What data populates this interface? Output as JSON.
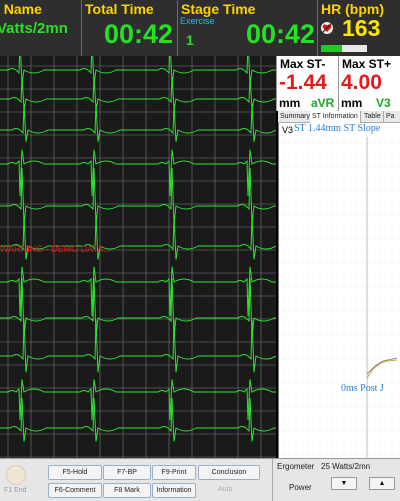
{
  "header": {
    "name": {
      "label": "l Name",
      "value": "Vatts/2mn"
    },
    "total_time": {
      "label": "Total Time",
      "value": "00:42"
    },
    "stage_time": {
      "label": "Stage Time",
      "sub_label": "Exercise",
      "stage_number": "1",
      "value": "00:42"
    },
    "heart_rate": {
      "label": "HR (bpm)",
      "value": "163",
      "icon": "heart-rate-icon",
      "fraction_of_bar": 0.45
    }
  },
  "st": {
    "max_minus": {
      "label": "Max ST-",
      "value": "-1.44",
      "unit": "mm",
      "lead": "aVR"
    },
    "max_plus": {
      "label": "Max ST+",
      "value": "4.00",
      "unit": "mm",
      "lead": "V3"
    }
  },
  "tabs": [
    {
      "label": "Summary",
      "active": false
    },
    {
      "label": "ST Information",
      "active": true
    },
    {
      "label": "Table",
      "active": false
    },
    {
      "label": "Pa",
      "active": false
    }
  ],
  "st_panel": {
    "lead": "V3",
    "headline": "ST 1.44mm ST Slope",
    "post_j": "0ms Post J"
  },
  "ecg": {
    "warning": "WARNING - DEMO DATA...",
    "colors": {
      "trace": "#2ee62e",
      "grid": "#7a7a7a",
      "background": "#1a1a1a"
    }
  },
  "buttons": {
    "end_label": "F1 End",
    "f5_hold": "F5-Hold",
    "f7_bp": "F7-BP",
    "f9_print": "F9-Print",
    "conclusion": "Conclusion",
    "f6_comment": "F6-Comment",
    "f8_mark": "F8 Mark",
    "information": "Information",
    "auto": "Auto"
  },
  "ergometer": {
    "label": "Ergometer",
    "value": "25 Watts/2mn",
    "power_label": "Power",
    "down_arrow": "▼",
    "up_arrow": "▲"
  }
}
